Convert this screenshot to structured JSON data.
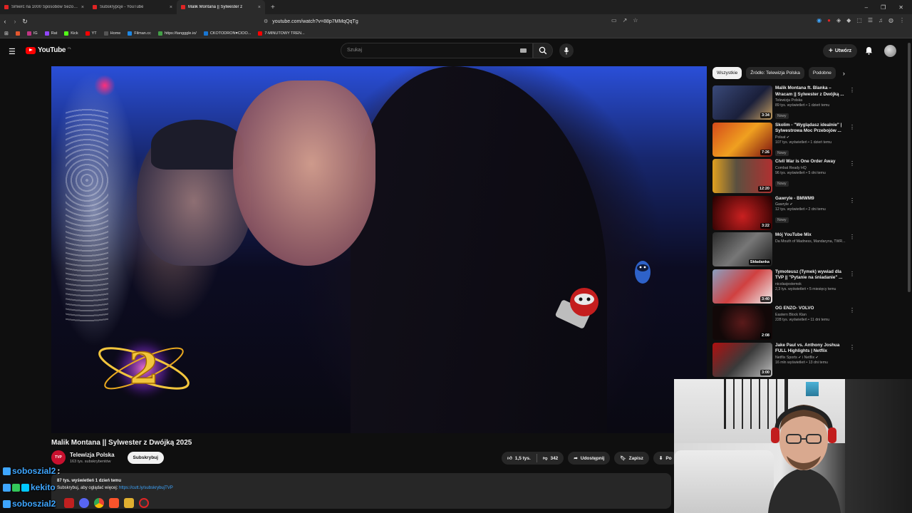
{
  "browser": {
    "tabs": [
      {
        "title": "Śmierć na 1000 Sposobów Sezon 2 O",
        "active": false
      },
      {
        "title": "Subskrypcje - YouTube",
        "active": false
      },
      {
        "title": "Malik Montana || Sylwester z",
        "active": true
      }
    ],
    "new_tab": "+",
    "url": "youtube.com/watch?v=88p7MMqQqTg",
    "bookmarks": [
      "IG",
      "Rat",
      "Kick",
      "YT",
      "Home",
      "Filman.cc",
      "https://tangggle.io/",
      "CKOTODRON♥CIOO...",
      "7-MINUTOWY TREN..."
    ]
  },
  "youtube": {
    "logo_text": "YouTube",
    "logo_country": "PL",
    "search_placeholder": "Szukaj",
    "create_label": "Utwórz",
    "video": {
      "title": "Malik Montana || Sylwester z Dwójką 2025",
      "channel_name": "Telewizja Polska",
      "channel_avatar_text": "TVP",
      "channel_subs": "163 tys. subskrybentów",
      "subscribe_label": "Subskrybuj",
      "likes": "1,5 tys.",
      "dislikes": "342",
      "share_label": "Udostępnij",
      "save_label": "Zapisz",
      "download_label": "Po",
      "description_meta": "87 tys. wyświetleń  1 dzień temu",
      "description_text": "Subskrybuj, aby oglądać więcej: ",
      "description_link": "https://cutt.ly/subskrybujTVP"
    },
    "chips": [
      "Wszystkie",
      "Źródło: Telewizja Polska",
      "Podobne"
    ],
    "recommendations": [
      {
        "title": "Malik Montana ft. Blanka – Wracam || Sylwester z Dwójką ...",
        "channel": "Telewizja Polska",
        "stats": "89 tys. wyświetleń • 1 dzień temu",
        "badge": "Nowy",
        "duration": "3:34"
      },
      {
        "title": "Skolim - \"Wyglądasz idealnie\" | Sylwestrowa Moc Przebojów ...",
        "channel": "Polsat ✔",
        "stats": "107 tys. wyświetleń • 1 dzień temu",
        "badge": "Nowy",
        "duration": "7:26"
      },
      {
        "title": "Civil War is One Order Away",
        "channel": "Combat Ready HQ",
        "stats": "96 tys. wyświetleń • 5 dni temu",
        "badge": "Nowy",
        "duration": "12:20"
      },
      {
        "title": "Gawryle - BMWM9",
        "channel": "Gawryle ✔",
        "stats": "12 tys. wyświetleń • 2 dni temu",
        "badge": "Nowy",
        "duration": "3:22"
      },
      {
        "title": "Mój YouTube Mix",
        "channel": "Da Mouth of Madness, Mandaryna, TWR...",
        "stats": "",
        "badge": "",
        "duration": "Składanka"
      },
      {
        "title": "Tymoteusz (Tymek) wywiad dla TVP || \"Pytanie na śniadanie\" ...",
        "channel": "nicolasjestemok",
        "stats": "2,3 tys. wyświetleń • 5 miesięcy temu",
        "badge": "",
        "duration": "3:40"
      },
      {
        "title": "OG ENZO-  VOLVO",
        "channel": "Eastern Block Klan",
        "stats": "228 tys. wyświetleń • 11 dni temu",
        "badge": "",
        "duration": "2:08"
      },
      {
        "title": "Jake Paul vs. Anthony Joshua FULL Highlights | Netflix",
        "channel": "Netflix Sports ✔ i Netflix ✔",
        "stats": "16 mln wyświetleń • 13 dni temu",
        "badge": "",
        "duration": "3:00"
      }
    ]
  },
  "overlay": {
    "badge_number": "2",
    "chat": [
      {
        "user": "soboszial2",
        "colon": ":"
      },
      {
        "user": "kekito",
        "colon": ""
      },
      {
        "user": "soboszial2",
        "colon": ""
      }
    ]
  },
  "colors": {
    "yt_red": "#ff0000",
    "link_blue": "#3ea6ff",
    "bg": "#0f0f0f",
    "chip_bg": "#272727"
  }
}
